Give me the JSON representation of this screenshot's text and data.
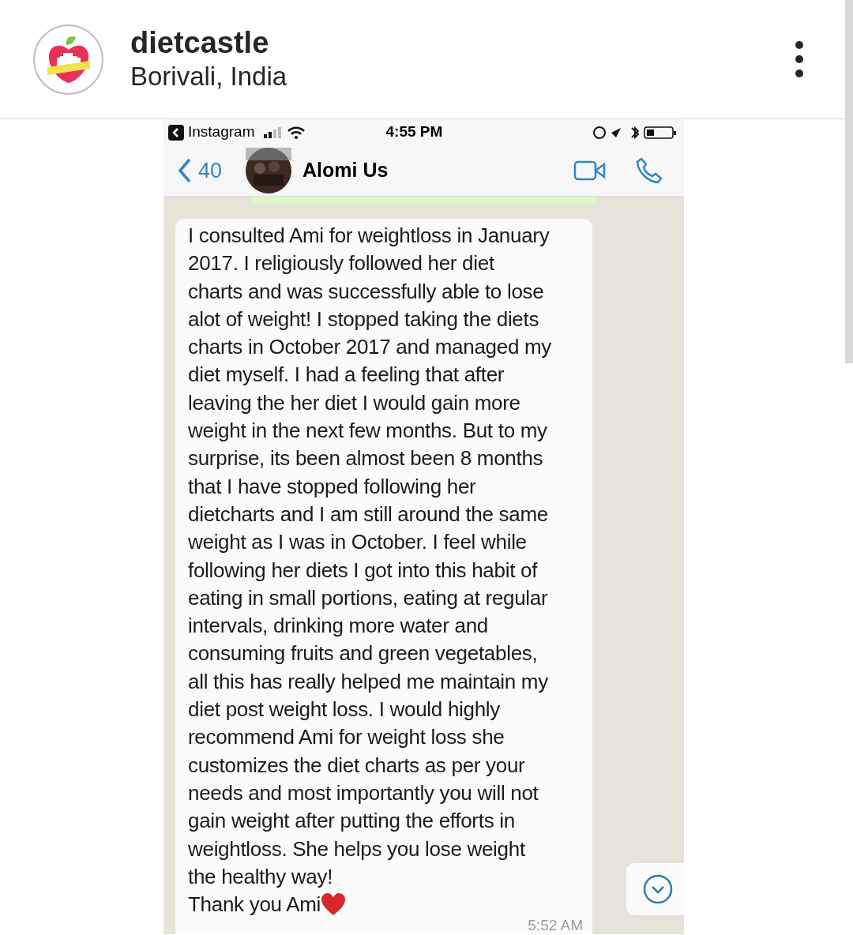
{
  "post_header": {
    "username": "dietcastle",
    "location": "Borivali, India"
  },
  "status_bar": {
    "back_app": "Instagram",
    "time": "4:55 PM"
  },
  "chat_header": {
    "back_count": "40",
    "contact_name": "Alomi Us"
  },
  "message": {
    "lines": [
      "I consulted Ami for weightloss in January",
      "2017. I religiously followed her diet",
      "charts and was successfully able to lose",
      "alot of weight! I stopped taking the diets",
      "charts in October 2017 and managed my",
      "diet myself. I had a feeling that after",
      "leaving the her diet I would gain more",
      "weight in the next few months. But to my",
      "surprise, its been almost been 8 months",
      "that I have stopped following her",
      "dietcharts and I am still around the same",
      "weight as I was in October. I feel while",
      "following her diets I got into this habit of",
      "eating in small portions, eating at regular",
      "intervals, drinking more water and",
      "consuming fruits and green vegetables,",
      "all this has really helped me maintain my",
      "diet post weight loss. I would highly",
      "recommend Ami for weight loss she",
      "customizes the diet charts as per your",
      "needs and most importantly you will not",
      "gain weight after putting the efforts in",
      "weightloss. She helps you lose weight",
      "the healthy way!",
      "Thank you Ami"
    ],
    "time": "5:52 AM"
  }
}
